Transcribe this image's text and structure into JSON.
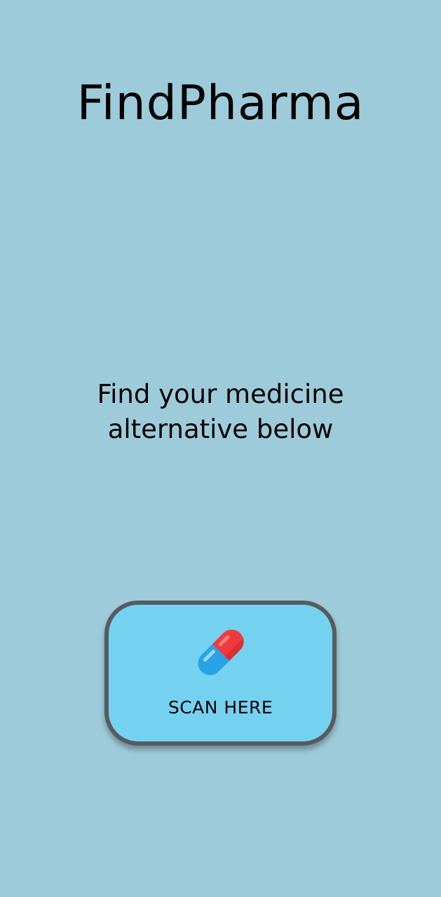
{
  "app": {
    "title": "FindPharma",
    "background_color": "#9ecbda"
  },
  "main": {
    "subtitle": "Find your medicine alternative below"
  },
  "scan_button": {
    "label": "SCAN HERE",
    "icon": "pill-icon",
    "background_color": "#74d2f0",
    "border_color": "#575b5e"
  }
}
